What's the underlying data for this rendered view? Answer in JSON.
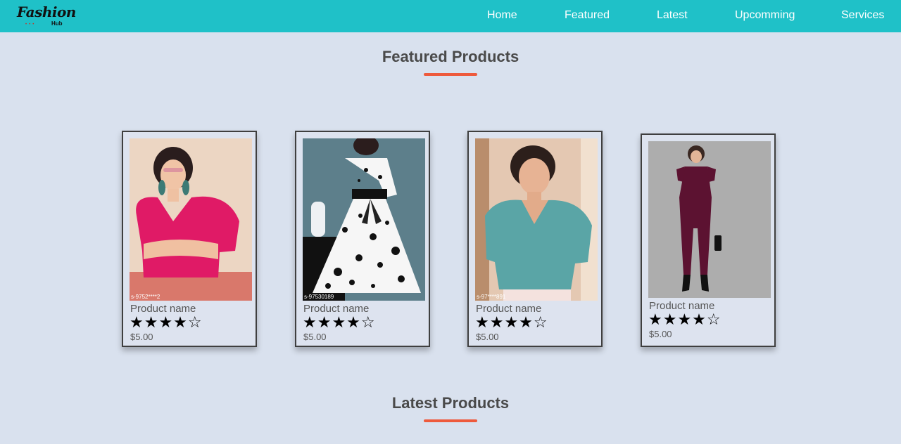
{
  "brand": {
    "name": "Fashion",
    "sub": "Hub"
  },
  "nav": [
    "Home",
    "Featured",
    "Latest",
    "Upcomming",
    "Services"
  ],
  "featured": {
    "title": "Featured Products",
    "products": [
      {
        "name": "Product name",
        "rating_text": "★★★★☆",
        "rating": 4,
        "price": "$5.00",
        "image_code": "s-9752****2",
        "image_desc": "woman-pink-puff-sleeve-top"
      },
      {
        "name": "Product name",
        "rating_text": "★★★★☆",
        "rating": 4,
        "price": "$5.00",
        "image_code": "s-97530189",
        "image_desc": "woman-polka-dot-dress"
      },
      {
        "name": "Product name",
        "rating_text": "★★★★☆",
        "rating": 4,
        "price": "$5.00",
        "image_code": "s-97****891",
        "image_desc": "woman-teal-top"
      },
      {
        "name": "Product name",
        "rating_text": "★★★★☆",
        "rating": 4,
        "price": "$5.00",
        "image_code": "",
        "image_desc": "woman-maroon-jumpsuit"
      }
    ]
  },
  "latest": {
    "title": "Latest Products"
  },
  "colors": {
    "navbar": "#1fc1c8",
    "accent": "#ee5a3c",
    "background": "#d9e1ee"
  }
}
